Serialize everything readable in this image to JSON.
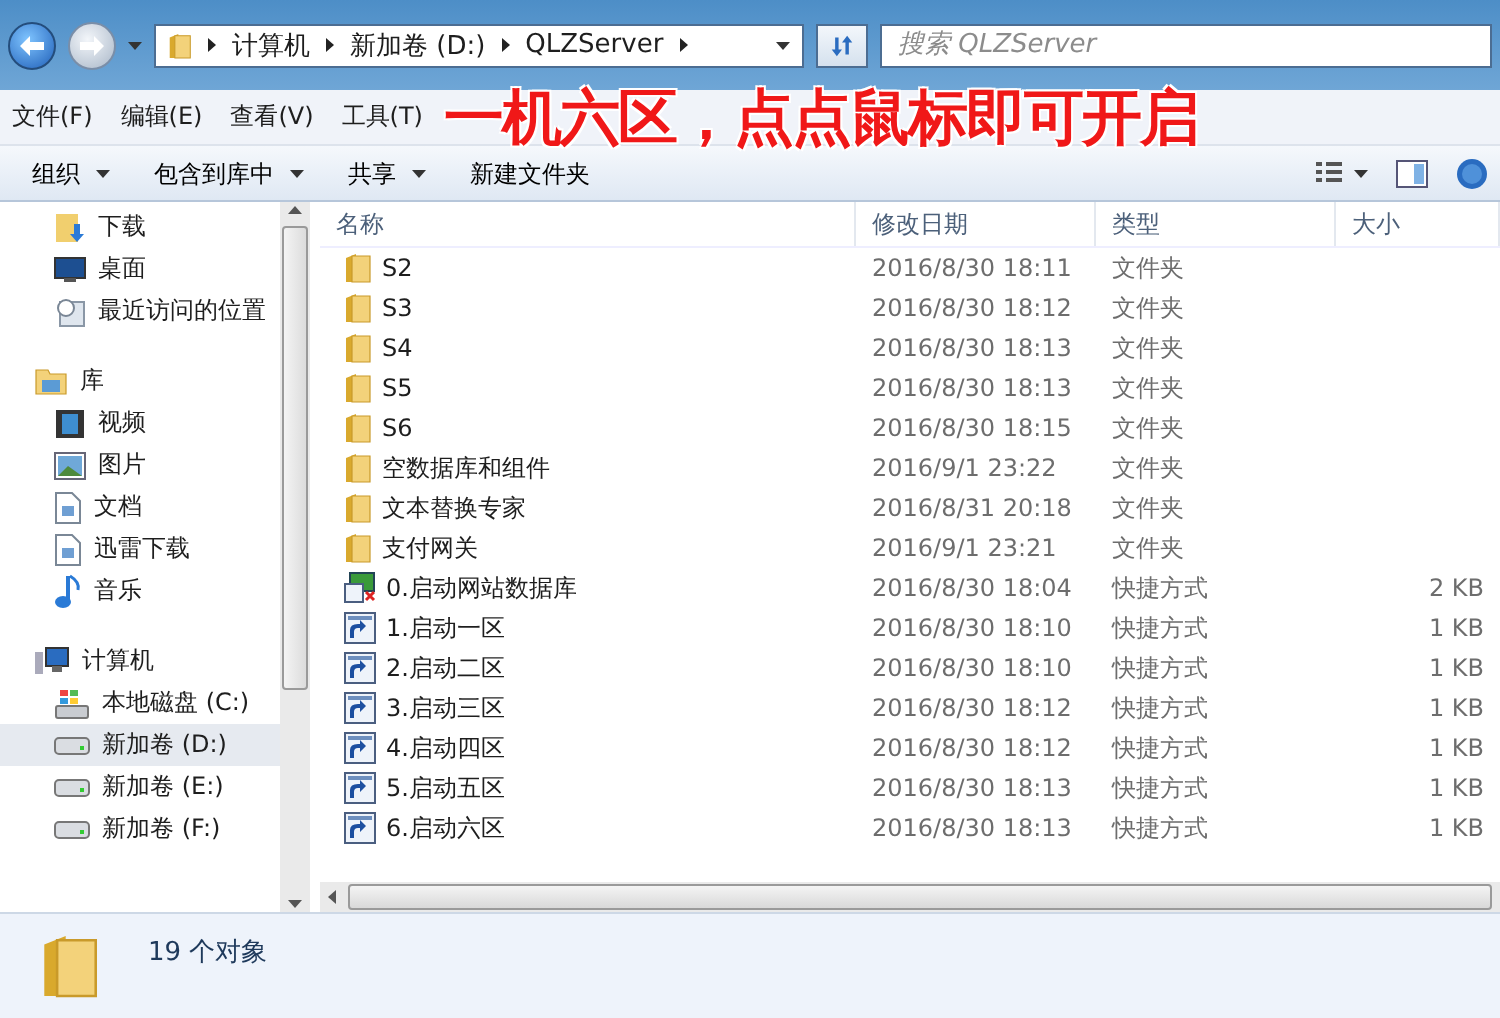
{
  "navigation": {
    "breadcrumbs": [
      "计算机",
      "新加卷 (D:)",
      "QLZServer"
    ],
    "search": {
      "placeholder": "搜索 QLZServer"
    }
  },
  "menu": [
    "文件(F)",
    "编辑(E)",
    "查看(V)",
    "工具(T)"
  ],
  "annotation": "一机六区，点点鼠标即可开启",
  "toolbar": [
    {
      "label": "组织",
      "dropdown": true
    },
    {
      "label": "包含到库中",
      "dropdown": true
    },
    {
      "label": "共享",
      "dropdown": true
    },
    {
      "label": "新建文件夹",
      "dropdown": false
    }
  ],
  "sidebar": {
    "sections": [
      {
        "items": [
          {
            "label": "下载",
            "kind": "download",
            "selected": false
          },
          {
            "label": "桌面",
            "kind": "desktop",
            "selected": false
          },
          {
            "label": "最近访问的位置",
            "kind": "recent",
            "selected": false
          }
        ]
      },
      {
        "label": "库",
        "kind": "library",
        "items": [
          {
            "label": "视频",
            "kind": "video",
            "selected": false
          },
          {
            "label": "图片",
            "kind": "picture",
            "selected": false
          },
          {
            "label": "文档",
            "kind": "document",
            "selected": false
          },
          {
            "label": "迅雷下载",
            "kind": "document",
            "selected": false
          },
          {
            "label": "音乐",
            "kind": "music",
            "selected": false
          }
        ]
      },
      {
        "label": "计算机",
        "kind": "computer",
        "items": [
          {
            "label": "本地磁盘 (C:)",
            "kind": "system-drive",
            "selected": false
          },
          {
            "label": "新加卷 (D:)",
            "kind": "drive",
            "selected": true
          },
          {
            "label": "新加卷 (E:)",
            "kind": "drive",
            "selected": false
          },
          {
            "label": "新加卷 (F:)",
            "kind": "drive",
            "selected": false
          }
        ]
      }
    ]
  },
  "table": {
    "columns": [
      "名称",
      "修改日期",
      "类型",
      "大小"
    ],
    "rows": [
      {
        "name": "S2",
        "date": "2016/8/30 18:11",
        "type": "文件夹",
        "size": "",
        "kind": "folder"
      },
      {
        "name": "S3",
        "date": "2016/8/30 18:12",
        "type": "文件夹",
        "size": "",
        "kind": "folder"
      },
      {
        "name": "S4",
        "date": "2016/8/30 18:13",
        "type": "文件夹",
        "size": "",
        "kind": "folder"
      },
      {
        "name": "S5",
        "date": "2016/8/30 18:13",
        "type": "文件夹",
        "size": "",
        "kind": "folder"
      },
      {
        "name": "S6",
        "date": "2016/8/30 18:15",
        "type": "文件夹",
        "size": "",
        "kind": "folder"
      },
      {
        "name": "空数据库和组件",
        "date": "2016/9/1 23:22",
        "type": "文件夹",
        "size": "",
        "kind": "folder"
      },
      {
        "name": "文本替换专家",
        "date": "2016/8/31 20:18",
        "type": "文件夹",
        "size": "",
        "kind": "folder"
      },
      {
        "name": "支付网关",
        "date": "2016/9/1 23:21",
        "type": "文件夹",
        "size": "",
        "kind": "folder"
      },
      {
        "name": "0.启动网站数据库",
        "date": "2016/8/30 18:04",
        "type": "快捷方式",
        "size": "2 KB",
        "kind": "app-shortcut"
      },
      {
        "name": "1.启动一区",
        "date": "2016/8/30 18:10",
        "type": "快捷方式",
        "size": "1 KB",
        "kind": "shortcut"
      },
      {
        "name": "2.启动二区",
        "date": "2016/8/30 18:10",
        "type": "快捷方式",
        "size": "1 KB",
        "kind": "shortcut"
      },
      {
        "name": "3.启动三区",
        "date": "2016/8/30 18:12",
        "type": "快捷方式",
        "size": "1 KB",
        "kind": "shortcut"
      },
      {
        "name": "4.启动四区",
        "date": "2016/8/30 18:12",
        "type": "快捷方式",
        "size": "1 KB",
        "kind": "shortcut"
      },
      {
        "name": "5.启动五区",
        "date": "2016/8/30 18:13",
        "type": "快捷方式",
        "size": "1 KB",
        "kind": "shortcut"
      },
      {
        "name": "6.启动六区",
        "date": "2016/8/30 18:13",
        "type": "快捷方式",
        "size": "1 KB",
        "kind": "shortcut"
      }
    ]
  },
  "status_bar": {
    "text": "19 个对象"
  }
}
